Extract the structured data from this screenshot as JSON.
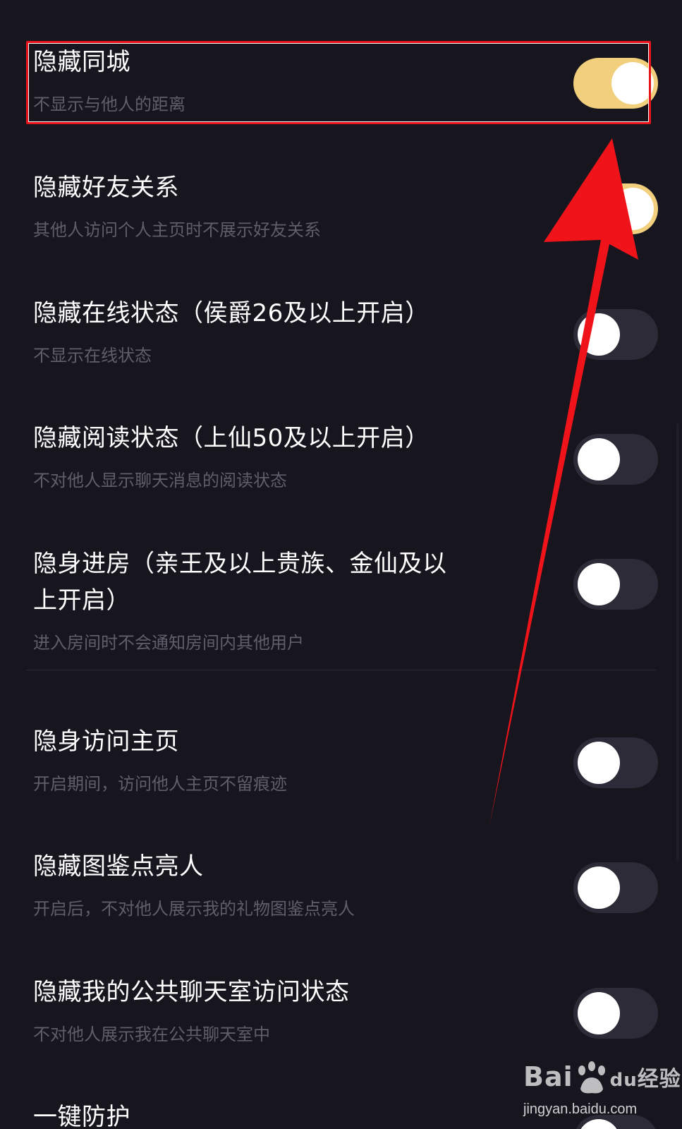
{
  "settings": [
    {
      "title": "隐藏同城",
      "subtitle": "不显示与他人的距离",
      "enabled": true
    },
    {
      "title": "隐藏好友关系",
      "subtitle": "其他人访问个人主页时不展示好友关系",
      "enabled": true
    },
    {
      "title": "隐藏在线状态（侯爵26及以上开启）",
      "subtitle": "不显示在线状态",
      "enabled": false
    },
    {
      "title": "隐藏阅读状态（上仙50及以上开启）",
      "subtitle": "不对他人显示聊天消息的阅读状态",
      "enabled": false
    },
    {
      "title": "隐身进房（亲王及以上贵族、金仙及以上开启）",
      "subtitle": "进入房间时不会通知房间内其他用户",
      "enabled": false
    },
    {
      "title": "隐身访问主页",
      "subtitle": "开启期间，访问他人主页不留痕迹",
      "enabled": false
    },
    {
      "title": "隐藏图鉴点亮人",
      "subtitle": "开启后，不对他人展示我的礼物图鉴点亮人",
      "enabled": false
    },
    {
      "title": "隐藏我的公共聊天室访问状态",
      "subtitle": "不对他人展示我在公共聊天室中",
      "enabled": false
    },
    {
      "title": "一键防护",
      "subtitle": "",
      "enabled": false
    }
  ],
  "watermark": {
    "brand_left": "Bai",
    "brand_mid": "du",
    "brand_right": "经验",
    "url": "jingyan.baidu.com"
  },
  "colors": {
    "background": "#17161f",
    "toggle_on": "#f2cf7c",
    "toggle_off": "#2c2b37",
    "highlight": "#e8141c",
    "arrow": "#f0141a"
  }
}
